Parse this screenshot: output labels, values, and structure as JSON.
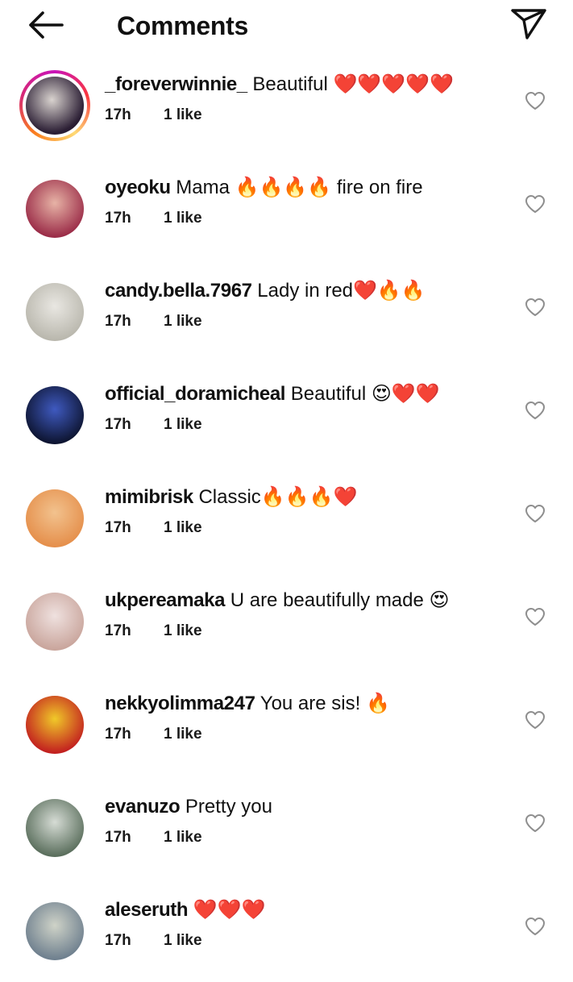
{
  "header": {
    "title": "Comments",
    "back_icon": "arrow-left-icon",
    "share_icon": "paper-plane-icon"
  },
  "colors": {
    "text": "#111111",
    "icon_gray": "#8e8e8e",
    "story_ring": [
      "#c913b9",
      "#f9373f",
      "#feda75",
      "#fa7e1e"
    ]
  },
  "comments": [
    {
      "username": "_foreverwinnie_",
      "text": "Beautiful ❤️❤️❤️❤️❤️",
      "time": "17h",
      "likes": "1 like",
      "has_story": true,
      "avatar_colors": [
        "#2a1d33",
        "#d9d3cf"
      ]
    },
    {
      "username": "oyeoku",
      "text": "Mama 🔥🔥🔥🔥 fire on fire",
      "time": "17h",
      "likes": "1 like",
      "has_story": false,
      "avatar_colors": [
        "#9a2b47",
        "#e7b3a6"
      ]
    },
    {
      "username": "candy.bella.7967",
      "text": "Lady in red❤️🔥🔥",
      "time": "17h",
      "likes": "1 like",
      "has_story": false,
      "avatar_colors": [
        "#b9b7ad",
        "#e9e7e2"
      ]
    },
    {
      "username": "official_doramicheal",
      "text": "Beautiful 😍❤️❤️",
      "time": "17h",
      "likes": "1 like",
      "has_story": false,
      "avatar_colors": [
        "#0d1430",
        "#3f5ac0"
      ]
    },
    {
      "username": "mimibrisk",
      "text": "Classic🔥🔥🔥❤️",
      "time": "17h",
      "likes": "1 like",
      "has_story": false,
      "avatar_colors": [
        "#e58f4b",
        "#f2c28e"
      ]
    },
    {
      "username": "ukpereamaka",
      "text": "U are beautifully made 😍",
      "time": "17h",
      "likes": "1 like",
      "has_story": false,
      "avatar_colors": [
        "#c9a59c",
        "#efe1df"
      ]
    },
    {
      "username": "nekkyolimma247",
      "text": "You are sis! 🔥",
      "time": "17h",
      "likes": "1 like",
      "has_story": false,
      "avatar_colors": [
        "#c21f1f",
        "#f0c929"
      ]
    },
    {
      "username": "evanuzo",
      "text": "Pretty you",
      "time": "17h",
      "likes": "1 like",
      "has_story": false,
      "avatar_colors": [
        "#5a6e5c",
        "#d6dcd5"
      ]
    },
    {
      "username": "aleseruth",
      "text": "❤️❤️❤️",
      "time": "17h",
      "likes": "1 like",
      "has_story": false,
      "avatar_colors": [
        "#6e7f8e",
        "#cfd3c8"
      ]
    }
  ]
}
